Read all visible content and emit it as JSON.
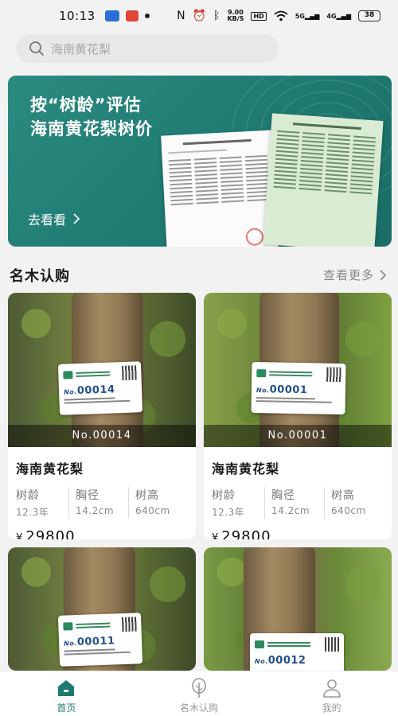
{
  "status_bar": {
    "time": "10:13",
    "speed_value": "9.00",
    "speed_unit": "KB/S",
    "hd": "HD",
    "net_a": "5G",
    "net_b": "4G",
    "battery": "38"
  },
  "search": {
    "placeholder": "海南黄花梨"
  },
  "banner": {
    "title_line1": "按“树龄”评估",
    "title_line2": "海南黄花梨树价",
    "cta": "去看看",
    "accent": "#1f7a72"
  },
  "section": {
    "title": "名木认购",
    "more": "查看更多"
  },
  "products": [
    {
      "number": "No.00014",
      "tag_number": "00014",
      "name": "海南黄花梨",
      "specs": [
        {
          "label": "树龄",
          "value": "12.3年"
        },
        {
          "label": "胸径",
          "value": "14.2cm"
        },
        {
          "label": "树高",
          "value": "640cm"
        }
      ],
      "currency": "¥",
      "price": "29800"
    },
    {
      "number": "No.00001",
      "tag_number": "00001",
      "name": "海南黄花梨",
      "specs": [
        {
          "label": "树龄",
          "value": "12.3年"
        },
        {
          "label": "胸径",
          "value": "14.2cm"
        },
        {
          "label": "树高",
          "value": "640cm"
        }
      ],
      "currency": "¥",
      "price": "29800"
    },
    {
      "tag_number": "00011"
    },
    {
      "tag_number": "00012"
    }
  ],
  "nav": [
    {
      "label": "首页",
      "icon": "home-icon",
      "active": true
    },
    {
      "label": "名木认购",
      "icon": "tree-icon",
      "active": false
    },
    {
      "label": "我的",
      "icon": "user-icon",
      "active": false
    }
  ]
}
